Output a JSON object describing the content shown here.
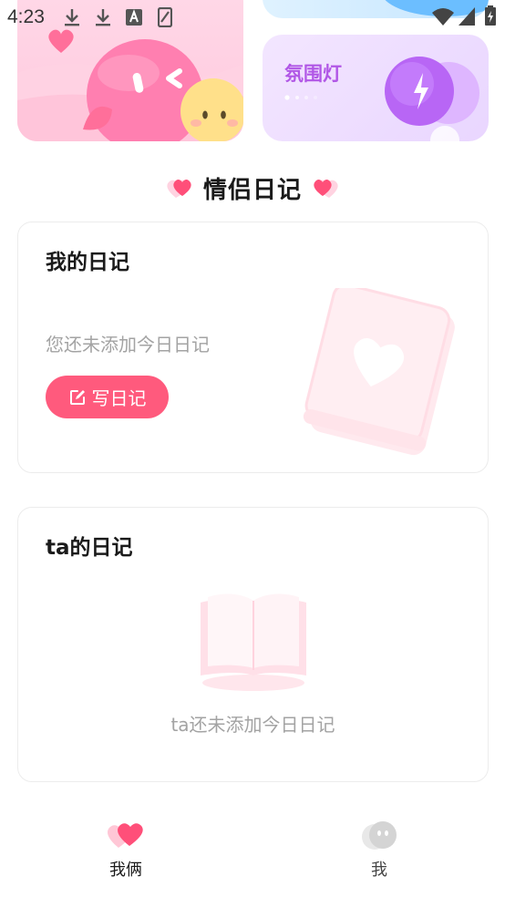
{
  "status_bar": {
    "time": "4:23",
    "icons": [
      "download-icon",
      "download-icon",
      "a-box-icon",
      "screenshot-icon",
      "wifi-icon",
      "signal-icon",
      "battery-icon"
    ]
  },
  "banners": {
    "atmosphere_light": {
      "title": "氛围灯"
    }
  },
  "section": {
    "title": "情侣日记"
  },
  "my_diary": {
    "heading": "我的日记",
    "empty_text": "您还未添加今日日记",
    "write_button": "写日记"
  },
  "ta_diary": {
    "heading": "ta的日记",
    "empty_text": "ta还未添加今日日记"
  },
  "bottom_nav": {
    "tabs": [
      {
        "label": "我俩",
        "icon": "couple-heart-icon",
        "active": true
      },
      {
        "label": "我",
        "icon": "face-icon",
        "active": false
      }
    ]
  },
  "colors": {
    "accent": "#ff5a7d",
    "atmosphere_text": "#b157e6",
    "muted_text": "#a3a3a3"
  }
}
